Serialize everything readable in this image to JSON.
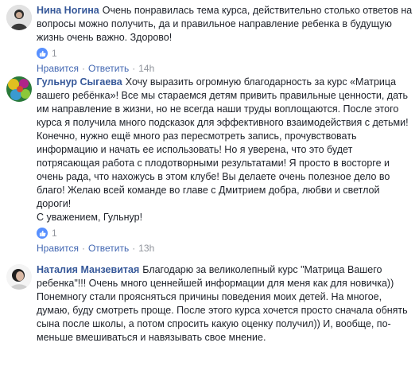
{
  "comments": [
    {
      "author": "Нина Ногина",
      "text": "Очень понравилась тема курса, действительно столько ответов на вопросы можно получить, да и правильное направление ребенка в будущую жизнь очень важно. Здорово!",
      "reactions": "1",
      "like_label": "Нравится",
      "reply_label": "Ответить",
      "time": "14h",
      "avatar_icon": "user-photo-icon"
    },
    {
      "author": "Гульнур Сыгаева",
      "text": "Хочу выразить огромную благодарность за курс «Матрица вашего ребёнка»! Все мы стараемся детям привить правильные ценности, дать им направление в жизни, но не всегда наши труды воплощаются. После этого курса я получила много подсказок для эффективного взаимодействия с детьми! Конечно, нужно ещё много раз пересмотреть запись, прочувствовать информацию и начать ее использовать! Но я уверена, что это будет потрясающая работа с плодотворными результатами! Я просто в восторге и очень рада, что нахожусь в этом клубе! Вы делаете очень полезное дело во благо! Желаю всей команде во главе с Дмитрием добра, любви и светлой дороги!",
      "signature": "С уважением, Гульнур!",
      "reactions": "1",
      "like_label": "Нравится",
      "reply_label": "Ответить",
      "time": "13h",
      "avatar_icon": "user-photo-icon"
    },
    {
      "author": "Наталия Манзевитая",
      "text": "Благодарю за великолепный курс \"Матрица Вашего ребенка\"!!! Очень много ценнейшей информации для меня как для новичка)) Понемногу стали проясняться причины поведения моих детей. На многое, думаю, буду смотреть проще. После этого курса хочется просто сначала обнять сына после школы, а потом спросить какую оценку получил)) И, вообще, по-меньше вмешиваться и навязывать свое мнение.",
      "avatar_icon": "user-photo-icon"
    }
  ],
  "colors": {
    "author": "#365899",
    "action": "#4267b2",
    "meta": "#90949c",
    "like_badge": "#5890ff"
  }
}
